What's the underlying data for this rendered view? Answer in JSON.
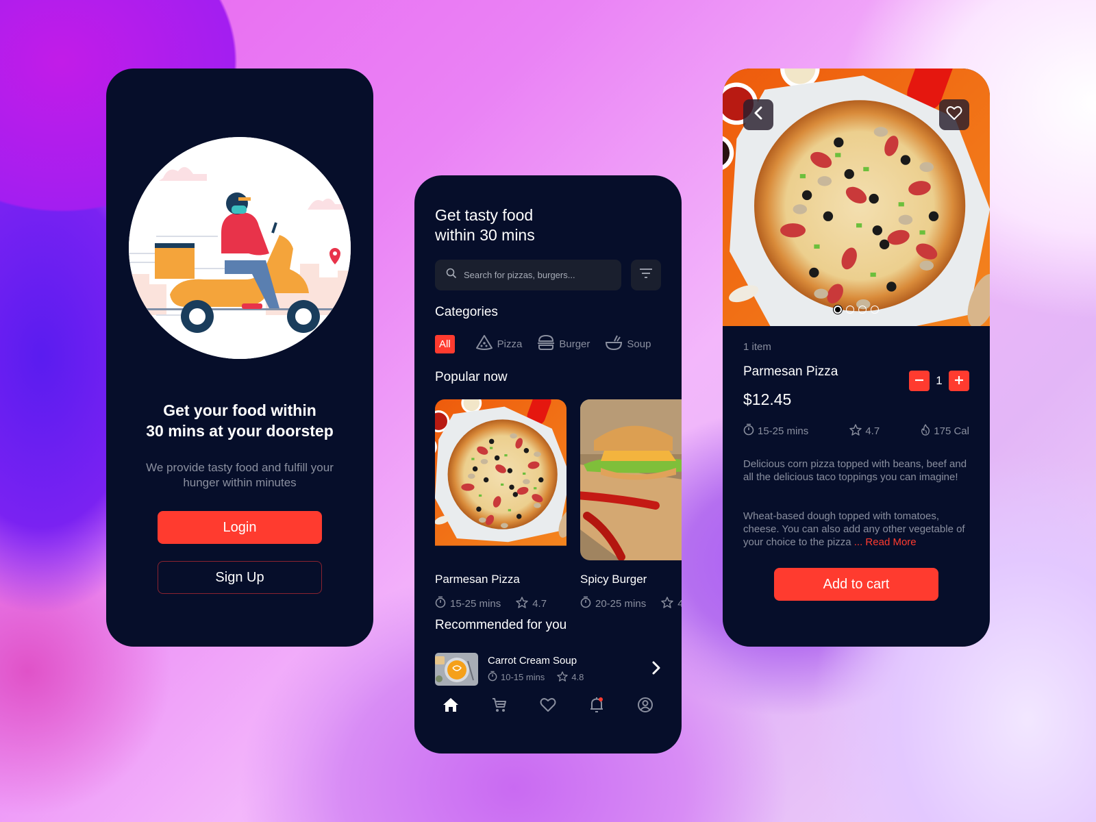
{
  "welcome": {
    "title_line1": "Get your food within",
    "title_line2": "30 mins at your doorstep",
    "subtitle_line1": "We provide tasty food and fulfill your",
    "subtitle_line2": "hunger within minutes",
    "login_label": "Login",
    "signup_label": "Sign Up"
  },
  "home": {
    "title_line1": "Get tasty food",
    "title_line2": "within 30 mins",
    "search_placeholder": "Search for pizzas, burgers...",
    "categories_title": "Categories",
    "categories": [
      {
        "label": "All",
        "icon": "all",
        "active": true
      },
      {
        "label": "Pizza",
        "icon": "pizza-icon"
      },
      {
        "label": "Burger",
        "icon": "burger-icon"
      },
      {
        "label": "Soup",
        "icon": "soup-icon"
      }
    ],
    "popular_title": "Popular now",
    "popular": [
      {
        "name": "Parmesan Pizza",
        "time": "15-25 mins",
        "rating": "4.7"
      },
      {
        "name": "Spicy Burger",
        "time": "20-25 mins",
        "rating": "4"
      }
    ],
    "recommended_title": "Recommended for you",
    "recommended": [
      {
        "name": "Carrot Cream Soup",
        "time": "10-15 mins",
        "rating": "4.8"
      }
    ],
    "nav": [
      {
        "icon": "home-icon",
        "active": true
      },
      {
        "icon": "cart-icon"
      },
      {
        "icon": "heart-icon"
      },
      {
        "icon": "bell-icon",
        "badge": true
      },
      {
        "icon": "profile-icon"
      }
    ]
  },
  "detail": {
    "item_count": "1 item",
    "name": "Parmesan Pizza",
    "price": "$12.45",
    "quantity": "1",
    "time": "15-25 mins",
    "rating": "4.7",
    "calories": "175 Cal",
    "carousel_pages": 4,
    "carousel_active": 1,
    "description_1": "Delicious corn pizza topped with beans, beef and all the delicious taco toppings you can imagine!",
    "description_2": "Wheat-based dough topped with tomatoes, cheese. You can also add any other vegetable of your choice to the pizza",
    "read_more": "... Read More",
    "add_to_cart_label": "Add to cart"
  },
  "colors": {
    "accent": "#ff3b2f",
    "panel_bg": "#060e2a",
    "muted_text": "#8a8f9f"
  }
}
